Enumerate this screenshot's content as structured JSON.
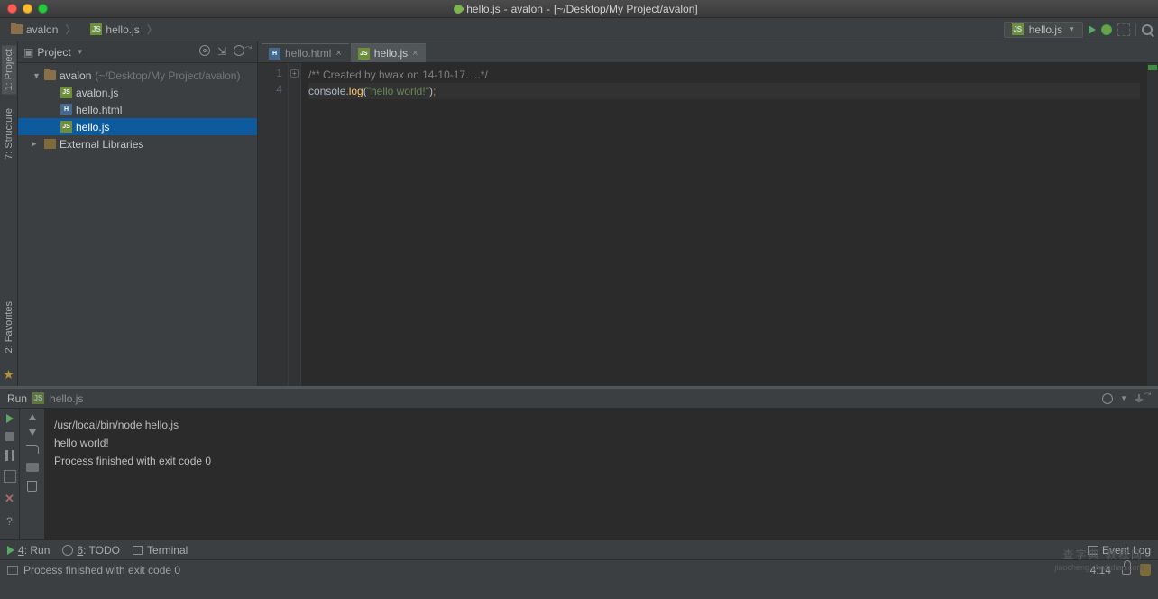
{
  "titlebar": {
    "filename": "hello.js",
    "project": "avalon",
    "path": "[~/Desktop/My Project/avalon]"
  },
  "breadcrumb": {
    "items": [
      {
        "label": "avalon",
        "icon": "folder"
      },
      {
        "label": "hello.js",
        "icon": "js"
      }
    ]
  },
  "run_config": {
    "selected": "hello.js"
  },
  "side_tabs": {
    "top": [
      {
        "label": "1: Project",
        "active": true
      },
      {
        "label": "7: Structure",
        "active": false
      }
    ],
    "bottom": [
      {
        "label": "2: Favorites",
        "active": false
      }
    ]
  },
  "project_panel": {
    "title": "Project",
    "tree": [
      {
        "depth": 0,
        "arrow": "▼",
        "icon": "folder",
        "label": "avalon",
        "suffix": " (~/Desktop/My Project/avalon)",
        "selected": false
      },
      {
        "depth": 1,
        "arrow": "",
        "icon": "js",
        "label": "avalon.js",
        "selected": false
      },
      {
        "depth": 1,
        "arrow": "",
        "icon": "html",
        "label": "hello.html",
        "selected": false
      },
      {
        "depth": 1,
        "arrow": "",
        "icon": "js",
        "label": "hello.js",
        "selected": true
      },
      {
        "depth": 0,
        "arrow": "▸",
        "icon": "lib",
        "label": "External Libraries",
        "selected": false
      }
    ]
  },
  "editor": {
    "tabs": [
      {
        "label": "hello.html",
        "icon": "html",
        "active": false
      },
      {
        "label": "hello.js",
        "icon": "js",
        "active": true
      }
    ],
    "gutter": [
      "1",
      "4"
    ],
    "lines": [
      {
        "tokens": [
          {
            "t": "/** Created by hwax on 14-10-17. ...*/",
            "c": "cm"
          }
        ],
        "folded": true
      },
      {
        "tokens": [
          {
            "t": "console",
            "c": "id"
          },
          {
            "t": ".",
            "c": "id"
          },
          {
            "t": "log",
            "c": "fn"
          },
          {
            "t": "(",
            "c": "id"
          },
          {
            "t": "\"hello world!\"",
            "c": "str"
          },
          {
            "t": ")",
            "c": "id"
          },
          {
            "t": ";",
            "c": "pn"
          }
        ],
        "current": true
      }
    ]
  },
  "run_panel": {
    "title": "Run",
    "config": "hello.js",
    "console": [
      "/usr/local/bin/node hello.js",
      "hello world!",
      "",
      "Process finished with exit code 0"
    ]
  },
  "tool_strip": {
    "items": [
      {
        "icon": "play",
        "label": "4: Run",
        "underline": "4"
      },
      {
        "icon": "todo",
        "label": "6: TODO",
        "underline": "6"
      },
      {
        "icon": "terminal",
        "label": "Terminal",
        "underline": ""
      }
    ],
    "right": "Event Log"
  },
  "status_bar": {
    "message": "Process finished with exit code 0",
    "position": "4:14"
  },
  "watermark": {
    "line1": "查字典 教程网",
    "line2": "jiaocheng.chazidian.com"
  }
}
